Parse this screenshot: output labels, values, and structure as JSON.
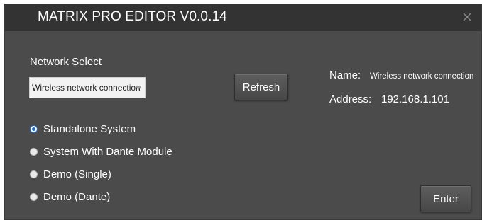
{
  "window": {
    "title": "MATRIX PRO EDITOR V0.0.14",
    "close_icon": "close-icon"
  },
  "network": {
    "label": "Network Select",
    "selected": "Wireless network connection",
    "refresh_label": "Refresh"
  },
  "info": {
    "name_label": "Name:",
    "name_value": "Wireless network connection",
    "address_label": "Address:",
    "address_value": "192.168.1.101"
  },
  "modes": {
    "selected_index": 0,
    "options": [
      {
        "label": "Standalone System",
        "checked": true
      },
      {
        "label": "System With Dante Module",
        "checked": false
      },
      {
        "label": "Demo (Single)",
        "checked": false
      },
      {
        "label": "Demo (Dante)",
        "checked": false
      }
    ]
  },
  "actions": {
    "enter_label": "Enter"
  },
  "colors": {
    "window_bg": "#4b4b4b",
    "titlebar_bg": "#333333",
    "radio_accent": "#1f6fd1"
  }
}
